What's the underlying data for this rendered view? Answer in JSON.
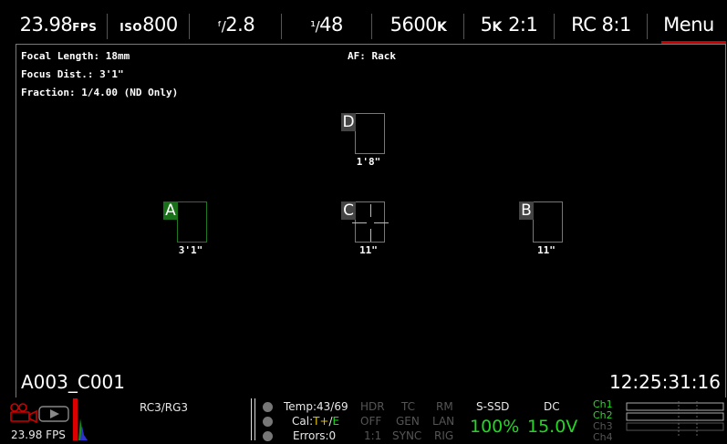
{
  "top_bar": {
    "fps": {
      "value": "23.98",
      "unit": "FPS"
    },
    "iso": {
      "prefix": "ISO",
      "value": "800"
    },
    "aperture": {
      "prefix": "ᶠ/",
      "value": "2.8"
    },
    "shutter": {
      "prefix": "¹/",
      "value": "48"
    },
    "white_balance": {
      "value": "5600",
      "unit": "K"
    },
    "resolution": {
      "value": "5",
      "unit": "K",
      "suffix": "2:1"
    },
    "compression": "RC 8:1",
    "menu": "Menu"
  },
  "lens_info": {
    "focal_length": "Focal Length: 18mm",
    "focus_distance": "Focus Dist.: 3'1\"",
    "fraction": "Fraction: 1/4.00 (ND Only)",
    "af_mode": "AF: Rack"
  },
  "focus_zones": [
    {
      "letter": "A",
      "distance": "3'1\"",
      "active": true
    },
    {
      "letter": "B",
      "distance": "11\"",
      "active": false
    },
    {
      "letter": "C",
      "distance": "11\"",
      "active": false
    },
    {
      "letter": "D",
      "distance": "1'8\"",
      "active": false
    }
  ],
  "clip_name": "A003_C001",
  "timecode": "12:25:31:16",
  "bottom_bar": {
    "fps_small": "23.98 FPS",
    "look": "RC3/RG3",
    "temp": "Temp:43/69",
    "cal": {
      "prefix": "Cal:",
      "t": "T+",
      "slash": "/",
      "e": "E"
    },
    "errors": "Errors:0",
    "hdr": "HDR",
    "off": "OFF",
    "ratio": "1:1",
    "tc": "TC",
    "gen": "GEN",
    "sync": "SYNC",
    "rm": "RM",
    "lan": "LAN",
    "rig": "RIG",
    "media_label": "S-SSD",
    "media_value": "100%",
    "power_label": "DC",
    "power_value": "15.0V",
    "channels": [
      "Ch1",
      "Ch2",
      "Ch3",
      "Ch4"
    ]
  },
  "colors": {
    "active_green": "#22d822",
    "menu_underline": "#cc0000",
    "zone_active": "#1f7a1f"
  }
}
